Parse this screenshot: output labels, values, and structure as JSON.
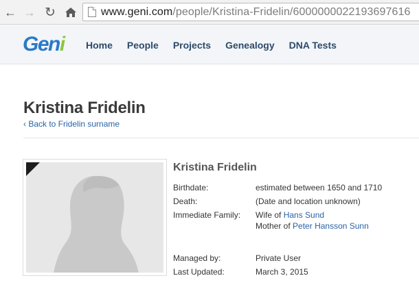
{
  "browser": {
    "url_host": "www.geni.com",
    "url_path": "/people/Kristina-Fridelin/6000000022193697616"
  },
  "header": {
    "logo": {
      "part1": "Gen",
      "part2": "i"
    },
    "nav": [
      "Home",
      "People",
      "Projects",
      "Genealogy",
      "DNA Tests"
    ]
  },
  "page": {
    "title": "Kristina Fridelin",
    "back_link": "‹ Back to Fridelin surname"
  },
  "profile": {
    "name": "Kristina Fridelin",
    "birthdate_label": "Birthdate:",
    "birthdate_value": "estimated between 1650 and 1710",
    "death_label": "Death:",
    "death_value": "(Date and location unknown)",
    "family_label": "Immediate Family:",
    "family_1_prefix": "Wife of",
    "family_1_link": "Hans Sund",
    "family_2_prefix": "Mother of",
    "family_2_link": "Peter Hansson Sunn",
    "managed_label": "Managed by:",
    "managed_value": "Private User",
    "updated_label": "Last Updated:",
    "updated_value": "March 3, 2015"
  }
}
